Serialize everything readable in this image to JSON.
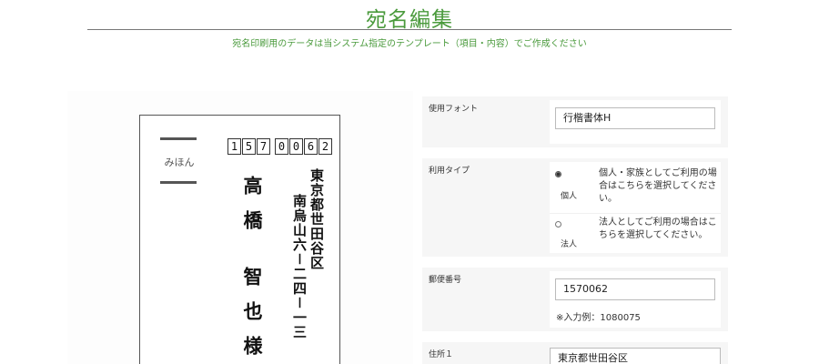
{
  "header": {
    "title": "宛名編集",
    "subtitle": "宛名印刷用のデータは当システム指定のテンプレート（項目・内容）でご作成ください"
  },
  "preview": {
    "sample_label": "みほん",
    "postal_digits": [
      "1",
      "5",
      "7",
      "0",
      "0",
      "6",
      "2"
    ],
    "address_line1": "東京都世田谷区",
    "address_line2": "南烏山六－二四－一三",
    "family_name": "高橋",
    "given_name": "智也",
    "honorific": "様"
  },
  "form": {
    "font": {
      "label": "使用フォント",
      "value": "行楷書体H"
    },
    "usage_type": {
      "label": "利用タイプ",
      "options": [
        {
          "name": "個人",
          "description": "個人・家族としてご利用の場合はこちらを選択してください。",
          "checked": true
        },
        {
          "name": "法人",
          "description": "法人としてご利用の場合はこちらを選択してください。",
          "checked": false
        }
      ]
    },
    "postal_code": {
      "label": "郵便番号",
      "value": "1570062",
      "hint": "※入力例：1080075"
    },
    "address1": {
      "label": "住所１",
      "value": "東京都世田谷区"
    }
  },
  "colors": {
    "accent": "#4a9a3c"
  }
}
